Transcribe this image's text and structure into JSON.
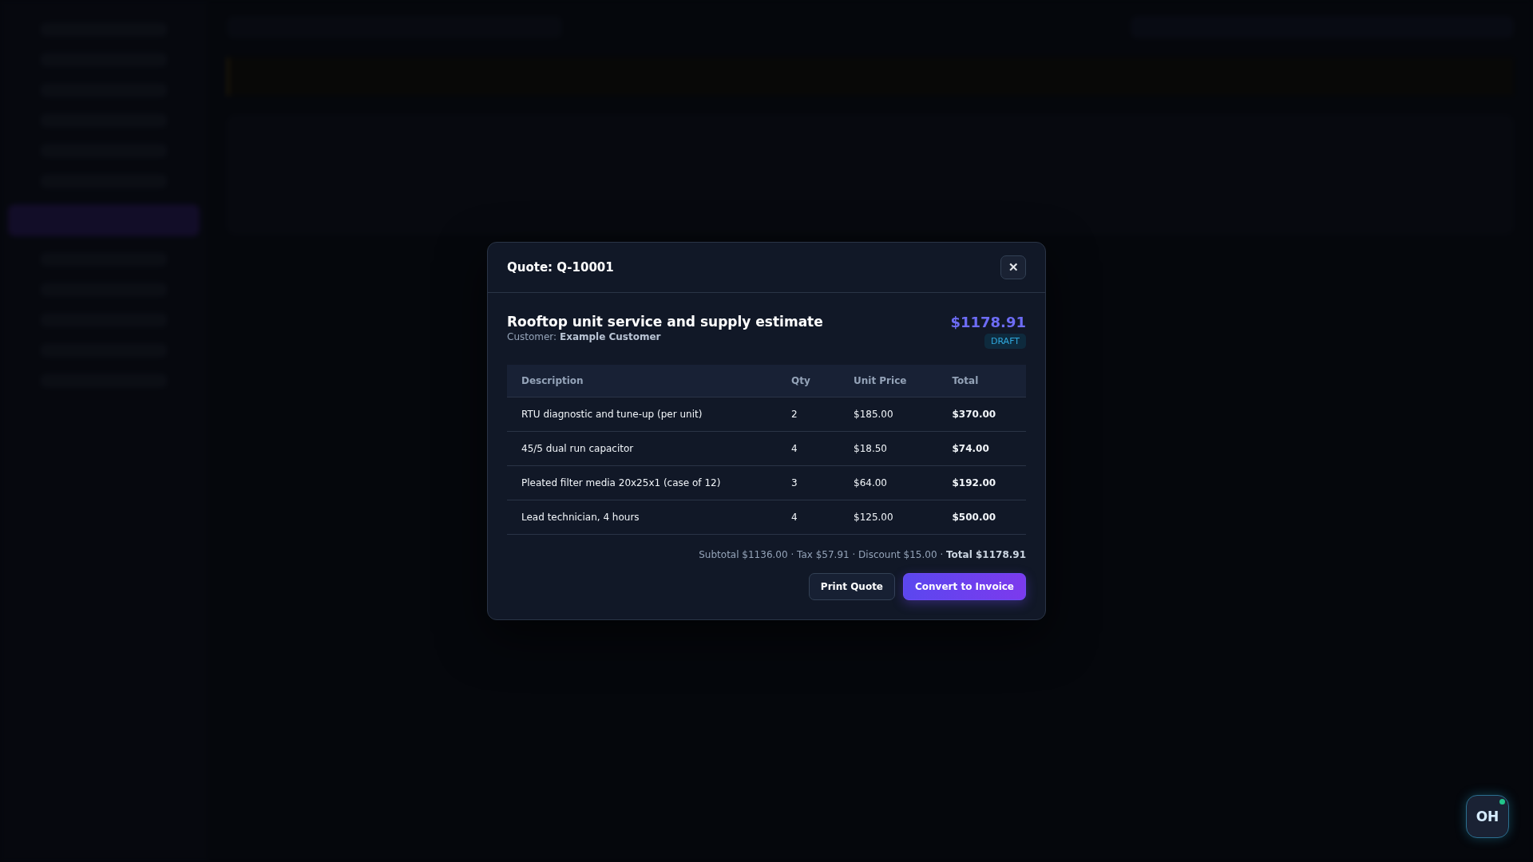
{
  "modal": {
    "title": "Quote: Q-10001",
    "close_label": "✕",
    "heading": "Rooftop unit service and supply estimate",
    "customer": "Customer: **Example Customer**",
    "amount": "$1178.91",
    "status": "DRAFT",
    "table": {
      "columns": [
        "Description",
        "Qty",
        "Unit Price",
        "Total"
      ],
      "rows": [
        [
          "RTU diagnostic and tune-up (per unit)",
          "2",
          "$185.00",
          "$370.00"
        ],
        [
          "45/5 dual run capacitor",
          "4",
          "$18.50",
          "$74.00"
        ],
        [
          "Pleated filter media 20x25x1 (case of 12)",
          "3",
          "$64.00",
          "$192.00"
        ],
        [
          "Lead technician, 4 hours",
          "4",
          "$125.00",
          "$500.00"
        ]
      ]
    },
    "summary": "Subtotal $1136.00 · Tax $57.91 · Discount $15.00 · **Total $1178.91**",
    "buttons": [
      {
        "label": "Print Quote",
        "kind": "secondary"
      },
      {
        "label": "Convert to Invoice",
        "kind": "primary"
      }
    ]
  },
  "chat_badge": {
    "initials": "OH",
    "online": true
  }
}
